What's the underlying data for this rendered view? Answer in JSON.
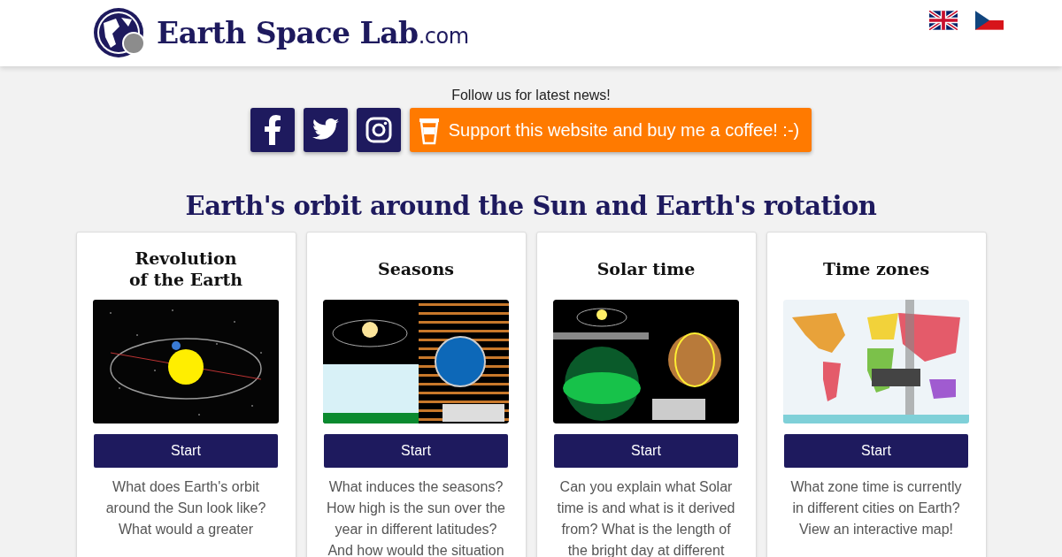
{
  "header": {
    "logo_text": "Earth Space Lab",
    "logo_suffix": ".com",
    "languages": [
      {
        "kind": "uk"
      },
      {
        "kind": "cz"
      }
    ]
  },
  "follow": {
    "text": "Follow us for latest news!",
    "social": [
      {
        "kind": "facebook"
      },
      {
        "kind": "twitter"
      },
      {
        "kind": "instagram"
      }
    ],
    "support_button": "Support this website and buy me a coffee! :-)"
  },
  "heading": "Earth's orbit around the Sun and Earth's rotation",
  "cards": [
    {
      "title": "Revolution\nof the Earth",
      "kind": "orbit",
      "button": "Start",
      "description": "What does Earth's orbit around the Sun look like? What would a greater"
    },
    {
      "title": "Seasons",
      "kind": "seasons",
      "button": "Start",
      "description": "What induces the seasons? How high is the sun over the year in different latitudes? And how would the situation"
    },
    {
      "title": "Solar time",
      "kind": "solar",
      "button": "Start",
      "description": "Can you explain what Solar time is and what is it derived from? What is the length of the bright day at different"
    },
    {
      "title": "Time zones",
      "kind": "map",
      "button": "Start",
      "description": "What zone time is currently in different cities on Earth? View an interactive map!"
    }
  ]
}
